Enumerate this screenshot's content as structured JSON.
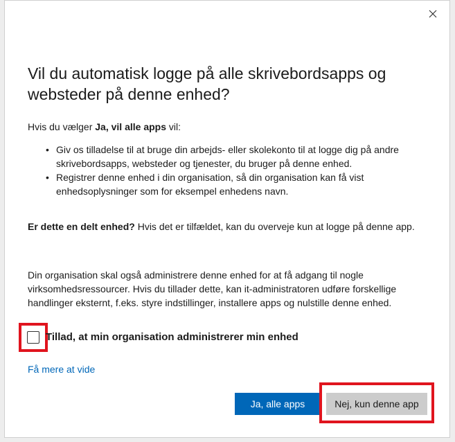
{
  "dialog": {
    "title": "Vil du automatisk logge på alle skrivebordsapps og websteder på denne enhed?",
    "intro_prefix": "Hvis du vælger ",
    "intro_bold": "Ja, vil alle apps",
    "intro_suffix": " vil:",
    "bullets": [
      "Giv os tilladelse til at bruge din arbejds- eller skolekonto til at logge dig på andre skrivebordsapps, websteder og tjenester, du bruger på denne enhed.",
      "Registrer denne enhed i din organisation, så din organisation kan få vist enhedsoplysninger som for eksempel enhedens navn."
    ],
    "shared_bold": "Er dette en delt enhed?",
    "shared_text": " Hvis det er tilfældet, kan du overveje kun at logge på denne app.",
    "manage_text": "Din organisation skal også administrere denne enhed for at få adgang til nogle virksomhedsressourcer. Hvis du tillader dette, kan it-administratoren udføre forskellige handlinger eksternt, f.eks. styre indstillinger, installere apps og nulstille denne enhed.",
    "checkbox_label": "Tillad, at min organisation administrerer min enhed",
    "checkbox_checked": false,
    "learn_more": "Få mere at vide",
    "primary_button": "Ja, alle apps",
    "secondary_button": "Nej, kun denne app",
    "close_icon": "close-icon"
  },
  "colors": {
    "accent": "#0067b8",
    "highlight": "#e0141e",
    "secondary_button": "#cccccc"
  }
}
